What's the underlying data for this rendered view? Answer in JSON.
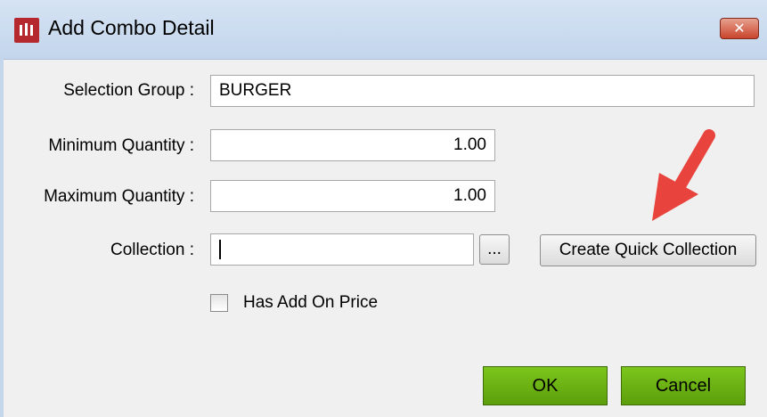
{
  "window": {
    "title": "Add Combo Detail",
    "close_label": "✕"
  },
  "form": {
    "selection_group_label": "Selection Group :",
    "selection_group_value": "BURGER",
    "min_qty_label": "Minimum Quantity :",
    "min_qty_value": "1.00",
    "max_qty_label": "Maximum Quantity :",
    "max_qty_value": "1.00",
    "collection_label": "Collection :",
    "collection_value": "",
    "browse_label": "...",
    "create_quick_collection_label": "Create Quick Collection",
    "has_add_on_price_label": "Has Add On Price",
    "has_add_on_price_checked": false
  },
  "footer": {
    "ok_label": "OK",
    "cancel_label": "Cancel"
  },
  "colors": {
    "annotation_arrow": "#e8433c",
    "ok_button": "#6cb414",
    "title_bar": "#c3d6ec",
    "app_icon": "#b5292e"
  }
}
